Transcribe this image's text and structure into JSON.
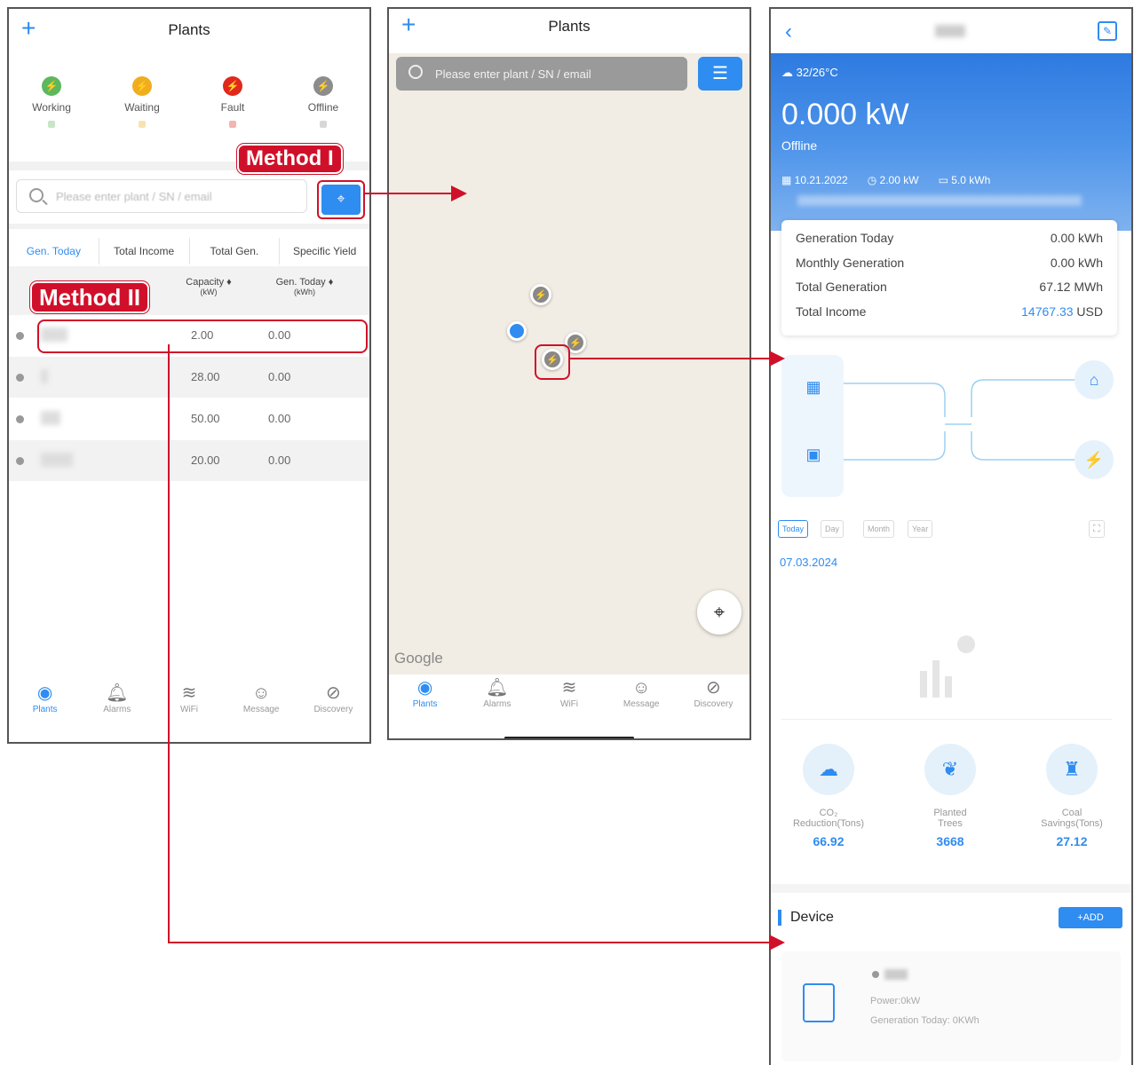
{
  "screen1": {
    "title": "Plants",
    "statuses": [
      {
        "label": "Working",
        "color": "#5cb85c"
      },
      {
        "label": "Waiting",
        "color": "#f0ad1e"
      },
      {
        "label": "Fault",
        "color": "#e0281c"
      },
      {
        "label": "Offline",
        "color": "#8c8c8c"
      }
    ],
    "search_placeholder": "Please enter plant / SN / email",
    "tabs": [
      "Gen. Today",
      "Total Income",
      "Total Gen.",
      "Specific Yield"
    ],
    "columns": {
      "capacity": "Capacity ♦",
      "capacity_unit": "(kW)",
      "gen_today": "Gen. Today ♦",
      "gen_unit": "(kWh)"
    },
    "rows": [
      {
        "capacity": "2.00",
        "gen": "0.00"
      },
      {
        "capacity": "28.00",
        "gen": "0.00"
      },
      {
        "capacity": "50.00",
        "gen": "0.00"
      },
      {
        "capacity": "20.00",
        "gen": "0.00"
      }
    ],
    "method1": "Method I",
    "method2": "Method II",
    "nav": [
      "Plants",
      "Alarms",
      "WiFi",
      "Message",
      "Discovery"
    ]
  },
  "screen2": {
    "title": "Plants",
    "search_placeholder": "Please enter plant / SN / email",
    "google": "Google",
    "nav": [
      "Plants",
      "Alarms",
      "WiFi",
      "Message",
      "Discovery"
    ]
  },
  "screen3": {
    "weather": "32/26°C",
    "power": "0.000 kW",
    "state": "Offline",
    "date": "10.21.2022",
    "capacity": "2.00 kW",
    "battery": "5.0 kWh",
    "stats": [
      {
        "label": "Generation Today",
        "value": "0.00 kWh"
      },
      {
        "label": "Monthly Generation",
        "value": "0.00 kWh"
      },
      {
        "label": "Total Generation",
        "value": "67.12 MWh"
      },
      {
        "label": "Total Income",
        "value": "14767.33",
        "unit": " USD"
      }
    ],
    "periods": [
      "Today",
      "Day",
      "Month",
      "Year"
    ],
    "chart_date": "07.03.2024",
    "eco": [
      {
        "l1": "CO₂",
        "l2": "Reduction(Tons)",
        "value": "66.92"
      },
      {
        "l1": "Planted",
        "l2": "Trees",
        "value": "3668"
      },
      {
        "l1": "Coal",
        "l2": "Savings(Tons)",
        "value": "27.12"
      }
    ],
    "device_title": "Device",
    "add_label": "+ADD",
    "device_power": "Power:0kW",
    "device_gen": "Generation Today: 0KWh"
  },
  "colors": {
    "accent": "#2f8cf0",
    "highlight": "#d0102a"
  }
}
